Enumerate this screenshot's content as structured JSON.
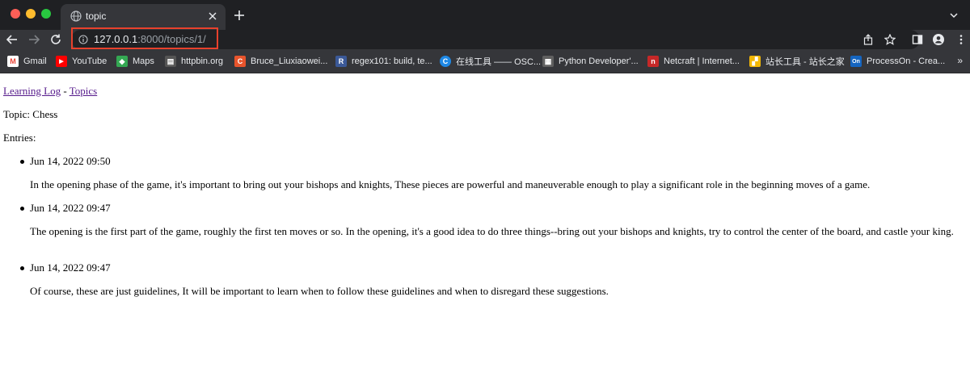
{
  "browser": {
    "tab_title": "topic",
    "url_host": "127.0.0.1",
    "url_path": ":8000/topics/1/",
    "highlight_color": "#e8412c"
  },
  "bookmarks": [
    {
      "label": "Gmail",
      "icon": "gmail-icon",
      "color": "#ea4335",
      "glyph": "M"
    },
    {
      "label": "YouTube",
      "icon": "youtube-icon",
      "color": "#ff0000",
      "glyph": "▶"
    },
    {
      "label": "Maps",
      "icon": "maps-icon",
      "color": "#34a853",
      "glyph": "◆"
    },
    {
      "label": "httpbin.org",
      "icon": "httpbin-icon",
      "color": "#555555",
      "glyph": "▤"
    },
    {
      "label": "Bruce_Liuxiaowei...",
      "icon": "csdn-icon",
      "color": "#e8542c",
      "glyph": "C"
    },
    {
      "label": "regex101: build, te...",
      "icon": "regex101-icon",
      "color": "#3b5998",
      "glyph": "R"
    },
    {
      "label": "在线工具 —— OSC...",
      "icon": "osc-icon",
      "color": "#1e88e5",
      "glyph": "C"
    },
    {
      "label": "Python Developer'...",
      "icon": "python-icon",
      "color": "#606060",
      "glyph": "▦"
    },
    {
      "label": "Netcraft | Internet...",
      "icon": "netcraft-icon",
      "color": "#c62828",
      "glyph": "n"
    },
    {
      "label": "站长工具 - 站长之家",
      "icon": "chinaz-icon",
      "color": "#f2b705",
      "glyph": "▞"
    },
    {
      "label": "ProcessOn - Crea...",
      "icon": "processon-icon",
      "color": "#1565c0",
      "glyph": "On"
    }
  ],
  "bookmarks_more": "»",
  "page": {
    "nav_home": "Learning Log",
    "nav_sep": " - ",
    "nav_topics": "Topics",
    "topic_line": "Topic: Chess",
    "entries_label": "Entries:",
    "entries": [
      {
        "date": "Jun 14, 2022 09:50",
        "text": "In the opening phase of the game, it's important to bring out your bishops and knights, These pieces are powerful and maneuverable enough to play a significant role in the beginning moves of a game."
      },
      {
        "date": "Jun 14, 2022 09:47",
        "text": "The opening is the first part of the game, roughly the first ten moves or so. In the opening, it's a good idea to do three things--bring out your bishops and knights, try to control the center of the board, and castle your king."
      },
      {
        "date": "Jun 14, 2022 09:47",
        "text": "Of course, these are just guidelines, It will be important to learn when to follow these guidelines and when to disregard these suggestions."
      }
    ]
  }
}
